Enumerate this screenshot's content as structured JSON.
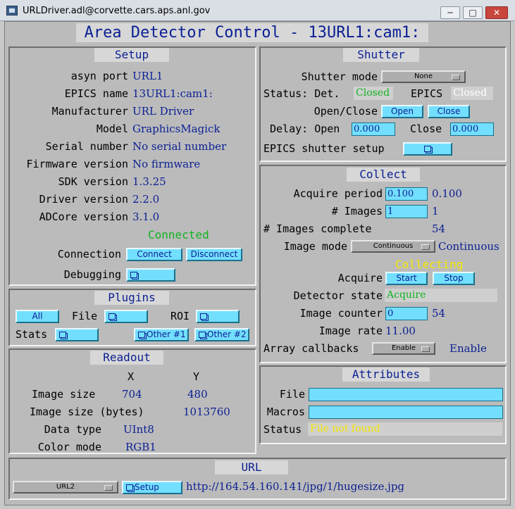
{
  "window": {
    "title": "URLDriver.adl@corvette.cars.aps.anl.gov",
    "min": "─",
    "max": "□",
    "close": "✕"
  },
  "main_title": "Area Detector Control - 13URL1:cam1:",
  "setup": {
    "title": "Setup",
    "asyn_port_label": "asyn port",
    "asyn_port": "URL1",
    "epics_name_label": "EPICS name",
    "epics_name": "13URL1:cam1:",
    "manufacturer_label": "Manufacturer",
    "manufacturer": "URL Driver",
    "model_label": "Model",
    "model": "GraphicsMagick",
    "serial_label": "Serial number",
    "serial": "No serial number",
    "firmware_label": "Firmware version",
    "firmware": "No firmware",
    "sdk_label": "SDK version",
    "sdk": "1.3.25",
    "driver_label": "Driver version",
    "driver": "2.2.0",
    "adcore_label": "ADCore version",
    "adcore": "3.1.0",
    "connected": "Connected",
    "connection_label": "Connection",
    "connect": "Connect",
    "disconnect": "Disconnect",
    "debugging_label": "Debugging"
  },
  "plugins": {
    "title": "Plugins",
    "all": "All",
    "file_label": "File",
    "roi_label": "ROI",
    "stats_label": "Stats",
    "other1": "Other #1",
    "other2": "Other #2"
  },
  "readout": {
    "title": "Readout",
    "x_label": "X",
    "y_label": "Y",
    "image_size_label": "Image size",
    "size_x": "704",
    "size_y": "480",
    "bytes_label": "Image size (bytes)",
    "bytes": "1013760",
    "data_type_label": "Data type",
    "data_type": "UInt8",
    "color_mode_label": "Color mode",
    "color_mode": "RGB1"
  },
  "shutter": {
    "title": "Shutter",
    "mode_label": "Shutter mode",
    "mode": "None",
    "status_label": "Status: Det.",
    "det_status": "Closed",
    "epics_label": "EPICS",
    "epics_status": "Closed",
    "openclose_label": "Open/Close",
    "open": "Open",
    "close": "Close",
    "delay_label": "Delay: Open",
    "delay_open": "0.000",
    "close_label": "Close",
    "delay_close": "0.000",
    "epics_setup_label": "EPICS shutter setup"
  },
  "collect": {
    "title": "Collect",
    "acquire_period_label": "Acquire period",
    "acquire_period_set": "0.100",
    "acquire_period": "0.100",
    "images_label": "# Images",
    "images_set": "1",
    "images": "1",
    "images_complete_label": "# Images complete",
    "images_complete": "54",
    "image_mode_label": "Image mode",
    "image_mode_menu": "Continuous",
    "image_mode": "Continuous",
    "collecting": "Collecting",
    "acquire_label": "Acquire",
    "start": "Start",
    "stop": "Stop",
    "detector_state_label": "Detector state",
    "detector_state": "Acquire",
    "image_counter_label": "Image counter",
    "image_counter_set": "0",
    "image_counter": "54",
    "image_rate_label": "Image rate",
    "image_rate": "11.00",
    "array_callbacks_label": "Array callbacks",
    "array_callbacks_menu": "Enable",
    "array_callbacks": "Enable"
  },
  "attributes": {
    "title": "Attributes",
    "file_label": "File",
    "file": "",
    "macros_label": "Macros",
    "macros": "",
    "status_label": "Status",
    "status": "File not found"
  },
  "url": {
    "title": "URL",
    "menu": "URL2",
    "setup": "Setup",
    "address": "http://164.54.160.141/jpg/1/hugesize.jpg"
  },
  "colors": {
    "label_blue": "#0a1f93",
    "button_cyan": "#73dfff",
    "ok_green": "#11b321",
    "warn_yellow": "#f5e700",
    "panel_gray": "#bbbbbb"
  },
  "icons": {
    "related_display": "related-display-icon",
    "menu_indicator": "menu-indicator-icon"
  }
}
